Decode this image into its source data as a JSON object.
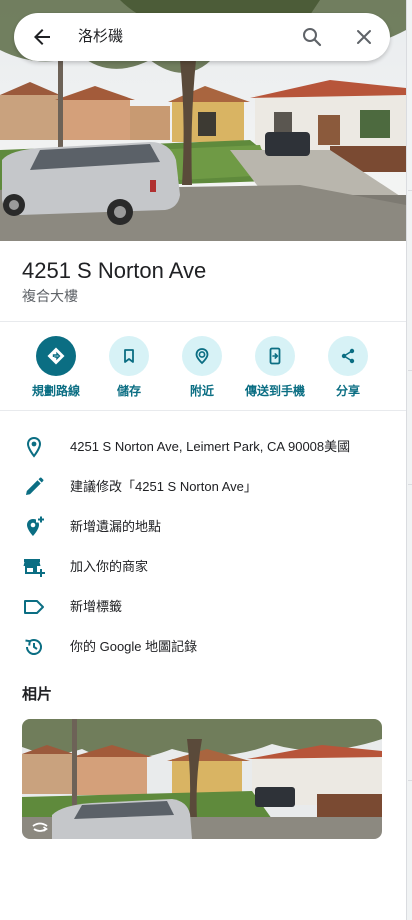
{
  "search": {
    "query": "洛杉磯"
  },
  "place": {
    "name": "4251 S Norton Ave",
    "category": "複合大樓"
  },
  "actions": [
    {
      "label": "規劃路線",
      "icon": "directions-icon"
    },
    {
      "label": "儲存",
      "icon": "bookmark-icon"
    },
    {
      "label": "附近",
      "icon": "nearby-icon"
    },
    {
      "label": "傳送到手機",
      "icon": "send-to-phone-icon"
    },
    {
      "label": "分享",
      "icon": "share-icon"
    }
  ],
  "info": [
    {
      "text": "4251 S Norton Ave, Leimert Park, CA 90008美國",
      "icon": "location-pin-icon"
    },
    {
      "text": "建議修改「4251 S Norton Ave」",
      "icon": "edit-pencil-icon"
    },
    {
      "text": "新增遺漏的地點",
      "icon": "add-place-icon"
    },
    {
      "text": "加入你的商家",
      "icon": "add-business-icon"
    },
    {
      "text": "新增標籤",
      "icon": "label-icon"
    },
    {
      "text": "你的 Google 地圖記錄",
      "icon": "history-icon"
    }
  ],
  "photos": {
    "heading": "相片"
  },
  "colors": {
    "accent": "#0b6e83",
    "accent_light": "#d7f2f6"
  }
}
